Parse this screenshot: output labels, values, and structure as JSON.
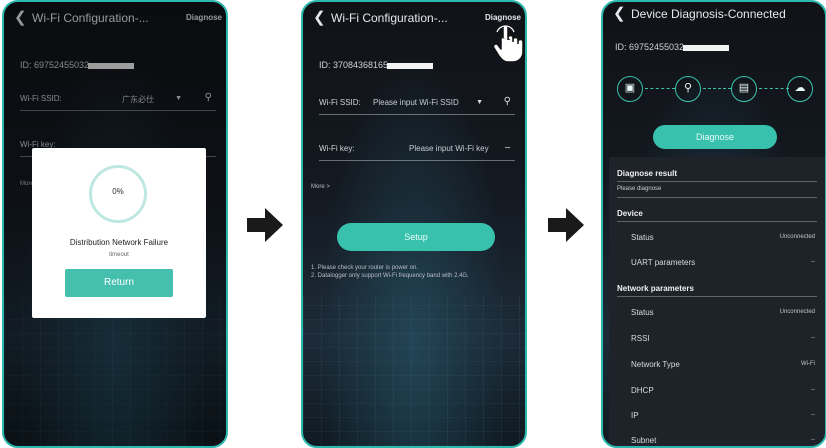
{
  "screen1": {
    "title": "Wi-Fi Configuration-...",
    "diagnose_label": "Diagnose",
    "id_prefix": "ID: 69752455032",
    "ssid_label": "Wi-Fi SSID:",
    "ssid_value": "广东必仕",
    "key_label": "Wi-Fi key:",
    "more_label": "More",
    "dialog": {
      "progress": "0%",
      "title": "Distribution Network Failure",
      "subtitle": "timeout",
      "return_button": "Return"
    }
  },
  "screen2": {
    "title": "Wi-Fi Configuration-...",
    "diagnose_label": "Diagnose",
    "id_prefix": "ID: 37084368165",
    "ssid_label": "Wi-Fi SSID:",
    "ssid_placeholder": "Please input Wi-Fi SSID",
    "key_label": "Wi-Fi key:",
    "key_placeholder": "Please input Wi-Fi key",
    "more_label": "More >",
    "setup_button": "Setup",
    "note1": "1. Please check your router is power on.",
    "note2": "2. Datalogger only support Wi-Fi frequency band with 2.4G."
  },
  "screen3": {
    "title": "Device Diagnosis-Connected",
    "id_prefix": "ID: 69752455032",
    "diagnose_button": "Diagnose",
    "result_header": "Diagnose result",
    "result_text": "Please diagnose",
    "device_header": "Device",
    "device_rows": [
      {
        "label": "Status",
        "value": "Unconnected"
      },
      {
        "label": "UART parameters",
        "value": "--"
      }
    ],
    "network_header": "Network parameters",
    "network_rows": [
      {
        "label": "Status",
        "value": "Unconnected"
      },
      {
        "label": "RSSI",
        "value": "--"
      },
      {
        "label": "Network Type",
        "value": "Wi-Fi"
      },
      {
        "label": "DHCP",
        "value": "--"
      },
      {
        "label": "IP",
        "value": "--"
      },
      {
        "label": "Subnet",
        "value": "--"
      }
    ]
  },
  "colors": {
    "accent": "#38c1ad",
    "phone_border": "#2bb8ad",
    "arrow": "#1a1a1a"
  }
}
